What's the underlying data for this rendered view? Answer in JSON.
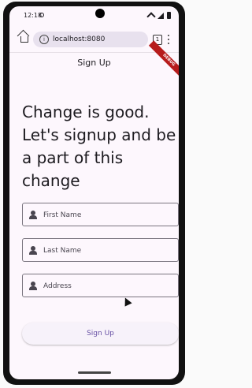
{
  "statusbar": {
    "time": "12:18"
  },
  "browser": {
    "url": "localhost:8080",
    "tab_count": "1"
  },
  "app": {
    "title": "Sign Up",
    "debug_label": "DEBUG",
    "headline": "Change is good. Let's signup and be a part of this change"
  },
  "form": {
    "first_name_placeholder": "First Name",
    "last_name_placeholder": "Last Name",
    "address_placeholder": "Address",
    "submit_label": "Sign Up"
  },
  "icons": {
    "home": "home-icon",
    "info": "info-icon",
    "tabs": "tabs-icon",
    "menu": "more-vert-icon",
    "person": "person-icon"
  }
}
